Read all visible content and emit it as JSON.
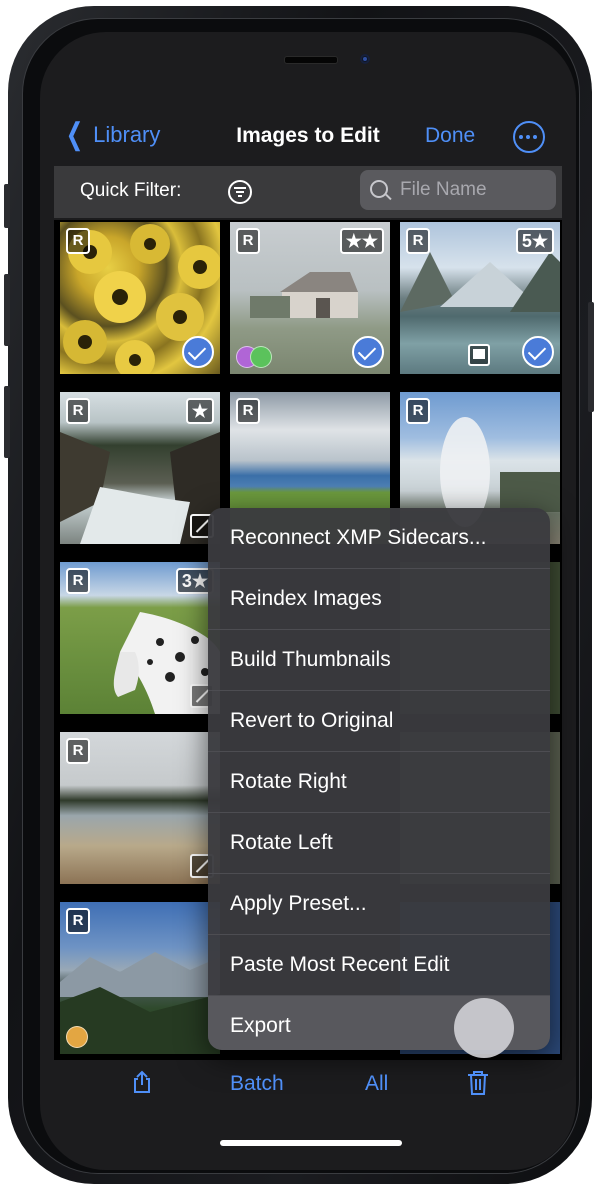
{
  "nav": {
    "back_label": "Library",
    "title": "Images to Edit",
    "done_label": "Done"
  },
  "filter": {
    "label": "Quick Filter:",
    "search_placeholder": "File Name"
  },
  "tiles": [
    {
      "raw_badge": "R",
      "rating": "",
      "state": "selected",
      "subject": "yellow flowers"
    },
    {
      "raw_badge": "R",
      "rating": "★★",
      "state": "selected",
      "subject": "barn"
    },
    {
      "raw_badge": "R",
      "rating": "5★",
      "state": "selected",
      "subject": "mountain lake"
    },
    {
      "raw_badge": "R",
      "rating": "★",
      "state": "edited",
      "subject": "river"
    },
    {
      "raw_badge": "R",
      "rating": "",
      "state": "",
      "subject": "meadow and sea"
    },
    {
      "raw_badge": "R",
      "rating": "",
      "state": "",
      "subject": "geyser"
    },
    {
      "raw_badge": "R",
      "rating": "3★",
      "state": "edited",
      "subject": "horse"
    },
    {
      "raw_badge": "R",
      "rating": "",
      "state": "edited",
      "subject": "hot spring"
    },
    {
      "raw_badge": "R",
      "rating": "",
      "state": "",
      "subject": "mountain valley"
    }
  ],
  "menu": {
    "items": [
      "Reconnect XMP Sidecars...",
      "Reindex Images",
      "Build Thumbnails",
      "Revert to Original",
      "Rotate Right",
      "Rotate Left",
      "Apply Preset...",
      "Paste Most Recent Edit",
      "Export"
    ],
    "highlighted_index": 8
  },
  "toolbar": {
    "batch_label": "Batch",
    "all_label": "All"
  },
  "colors": {
    "accent": "#4f8ff7",
    "selected_check": "#4a7bd8",
    "menu_bg": "#3a3a3e"
  },
  "icons": [
    "chevron-left-icon",
    "more-icon",
    "filter-icon",
    "search-icon",
    "share-icon",
    "trash-icon",
    "checkmark-icon",
    "edited-icon",
    "flag-icon"
  ]
}
